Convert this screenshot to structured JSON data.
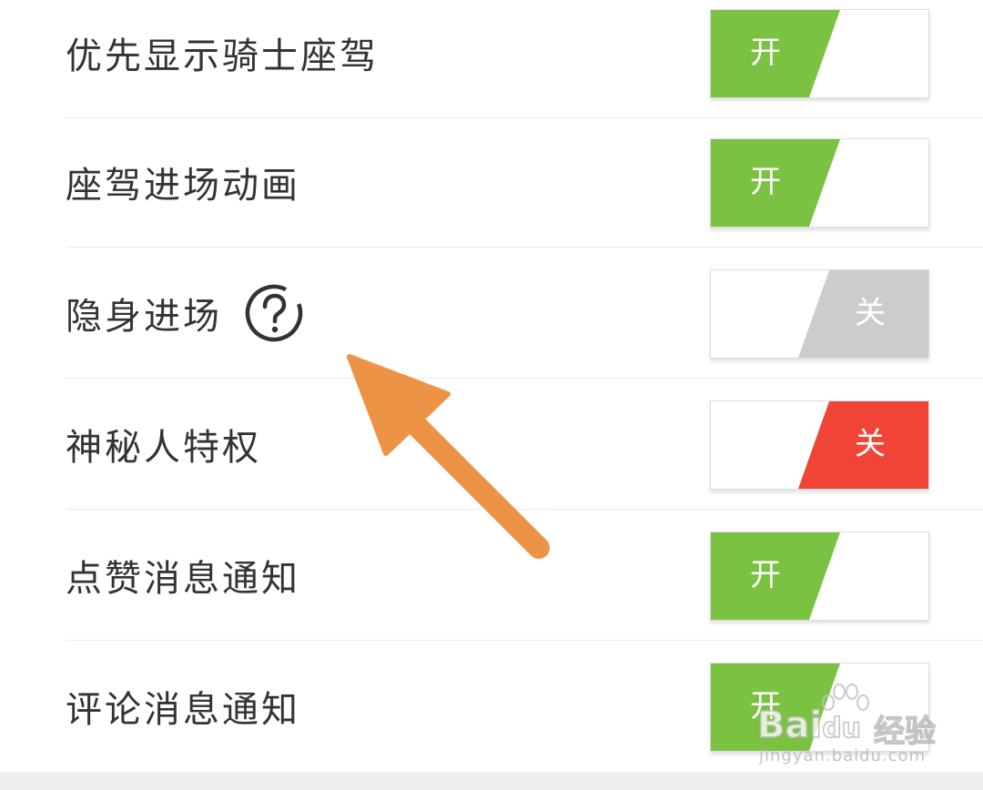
{
  "settings": [
    {
      "label": "优先显示骑士座驾",
      "toggle": {
        "state": "on",
        "text": "开",
        "color": "#7cc242"
      }
    },
    {
      "label": "座驾进场动画",
      "toggle": {
        "state": "on",
        "text": "开",
        "color": "#7cc242"
      }
    },
    {
      "label": "隐身进场",
      "help_icon": "question-circle-icon",
      "toggle": {
        "state": "off",
        "text": "关",
        "color": "#cccccc"
      }
    },
    {
      "label": "神秘人特权",
      "toggle": {
        "state": "off",
        "text": "关",
        "color": "#f04437"
      }
    },
    {
      "label": "点赞消息通知",
      "toggle": {
        "state": "on",
        "text": "开",
        "color": "#7cc242"
      }
    },
    {
      "label": "评论消息通知",
      "toggle": {
        "state": "on",
        "text": "开",
        "color": "#7cc242"
      }
    }
  ],
  "annotation": {
    "icon": "arrow-up-left-icon",
    "color": "#ed9346"
  },
  "watermark": {
    "brand": "Bai",
    "brand_suffix": "du",
    "chinese": "经验",
    "url": "jingyan.baidu.com"
  }
}
